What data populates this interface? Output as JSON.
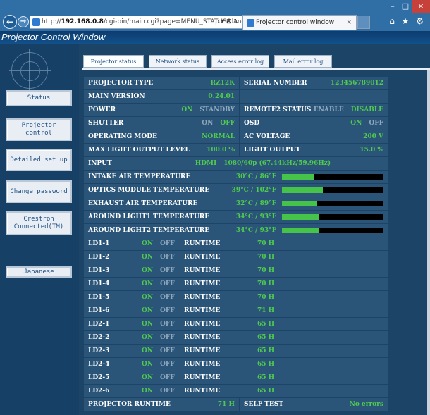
{
  "browser": {
    "url_prefix": "http://",
    "url_host": "192.168.0.8",
    "url_path": "/cgi-bin/main.cgi?page=MENU_STATUS&lang=e",
    "url_tools": "ρ ▾ ⊠ ↻",
    "tab_title": "Projector control window",
    "tab_close": "×",
    "right_tools": "⌂ ★ ⚙",
    "win_buttons": [
      "–",
      "□",
      "×"
    ]
  },
  "app": {
    "title": "Projector Control Window"
  },
  "nav": {
    "items": [
      {
        "label": "Status"
      },
      {
        "label": "Projector control"
      },
      {
        "label": "Detailed set up"
      },
      {
        "label": "Change password"
      },
      {
        "label": "Crestron Connected(TM)"
      },
      {
        "label": "Japanese"
      }
    ]
  },
  "tabs": [
    {
      "label": "Projector status",
      "active": true
    },
    {
      "label": "Network status"
    },
    {
      "label": "Access error log"
    },
    {
      "label": "Mail error log"
    }
  ],
  "status": {
    "projector_type": {
      "label": "PROJECTOR TYPE",
      "value": "RZ12K"
    },
    "serial_number": {
      "label": "SERIAL NUMBER",
      "value": "123456789012"
    },
    "main_version": {
      "label": "MAIN VERSION",
      "value": "0.24.01"
    },
    "power": {
      "label": "POWER",
      "on": "ON",
      "standby": "STANDBY"
    },
    "remote2": {
      "label": "REMOTE2 STATUS",
      "enable": "ENABLE",
      "disable": "DISABLE"
    },
    "shutter": {
      "label": "SHUTTER",
      "on": "ON",
      "off": "OFF"
    },
    "osd": {
      "label": "OSD",
      "on": "ON",
      "off": "OFF"
    },
    "operating_mode": {
      "label": "OPERATING MODE",
      "value": "NORMAL"
    },
    "ac_voltage": {
      "label": "AC VOLTAGE",
      "value": "200 V"
    },
    "max_light": {
      "label": "MAX LIGHT OUTPUT LEVEL",
      "value": "100.0 %"
    },
    "light_output": {
      "label": "LIGHT OUTPUT",
      "value": "15.0 %"
    },
    "input": {
      "label": "INPUT",
      "source": "HDMI",
      "signal": "1080/60p (67.44kHz/59.96Hz)"
    },
    "temperatures": [
      {
        "label": "INTAKE AIR TEMPERATURE",
        "value": "30°C / 86°F",
        "level": 0.32
      },
      {
        "label": "OPTICS MODULE TEMPERATURE",
        "value": "39°C / 102°F",
        "level": 0.4
      },
      {
        "label": "EXHAUST AIR TEMPERATURE",
        "value": "32°C / 89°F",
        "level": 0.34
      },
      {
        "label": "AROUND LIGHT1 TEMPERATURE",
        "value": "34°C / 93°F",
        "level": 0.36
      },
      {
        "label": "AROUND LIGHT2 TEMPERATURE",
        "value": "34°C / 93°F",
        "level": 0.36
      }
    ],
    "ld_on": "ON",
    "ld_off": "OFF",
    "ld_runtime_label": "RUNTIME",
    "lds": [
      {
        "name": "LD1-1",
        "runtime": "70 H"
      },
      {
        "name": "LD1-2",
        "runtime": "70 H"
      },
      {
        "name": "LD1-3",
        "runtime": "70 H"
      },
      {
        "name": "LD1-4",
        "runtime": "70 H"
      },
      {
        "name": "LD1-5",
        "runtime": "70 H"
      },
      {
        "name": "LD1-6",
        "runtime": "71 H"
      },
      {
        "name": "LD2-1",
        "runtime": "65 H"
      },
      {
        "name": "LD2-2",
        "runtime": "65 H"
      },
      {
        "name": "LD2-3",
        "runtime": "65 H"
      },
      {
        "name": "LD2-4",
        "runtime": "65 H"
      },
      {
        "name": "LD2-5",
        "runtime": "65 H"
      },
      {
        "name": "LD2-6",
        "runtime": "65 H"
      }
    ],
    "projector_runtime": {
      "label": "PROJECTOR RUNTIME",
      "value": "71 H"
    },
    "self_test": {
      "label": "SELF TEST",
      "value": "No errors"
    }
  },
  "colors": {
    "ok_green": "#4fc94f",
    "dim_gray": "#8fa7bd",
    "panel_blue": "#2a5578",
    "bg_blue": "#1b4466"
  }
}
